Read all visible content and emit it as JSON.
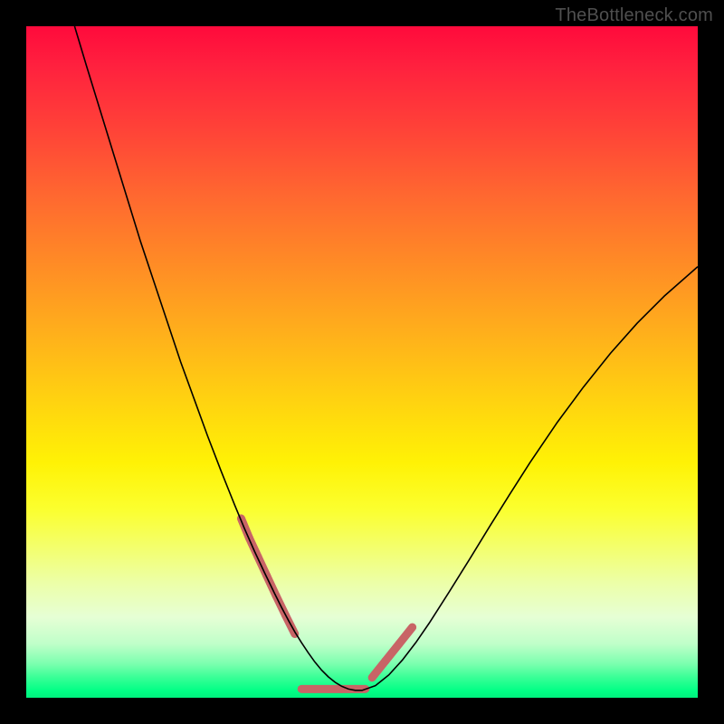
{
  "watermark": "TheBottleneck.com",
  "chart_data": {
    "type": "line",
    "title": "",
    "xlabel": "",
    "ylabel": "",
    "xlim": [
      0,
      100
    ],
    "ylim": [
      0,
      100
    ],
    "grid": false,
    "series": [
      {
        "name": "curve",
        "stroke": "#000000",
        "width": 1.6,
        "x": [
          7.2,
          9,
          11,
          13,
          15,
          17,
          19,
          21,
          23,
          25,
          27,
          29,
          31,
          32.5,
          34,
          35.5,
          37,
          38,
          39,
          40,
          41,
          42,
          43,
          44,
          45,
          46,
          47,
          48,
          49,
          50,
          52,
          54,
          56,
          58,
          60,
          63,
          66,
          69,
          72,
          75,
          79,
          83,
          87,
          91,
          95,
          100
        ],
        "y": [
          100,
          94,
          87.5,
          81,
          74.5,
          68,
          62,
          56,
          50,
          44.5,
          39,
          33.8,
          28.8,
          25.2,
          21.8,
          18.6,
          15.5,
          13.5,
          11.6,
          9.8,
          8.2,
          6.7,
          5.3,
          4.1,
          3.1,
          2.3,
          1.7,
          1.3,
          1.1,
          1.1,
          1.8,
          3.4,
          5.6,
          8.2,
          11.1,
          15.8,
          20.6,
          25.5,
          30.3,
          35,
          40.9,
          46.3,
          51.3,
          55.8,
          59.8,
          64.2
        ]
      }
    ],
    "highlights": [
      {
        "name": "dash-left",
        "stroke": "#c86466",
        "width": 9,
        "cap": "round",
        "x": [
          32.0,
          33.2,
          34.5,
          35.8,
          37.2,
          38.6,
          40.0
        ],
        "y": [
          26.7,
          23.8,
          21.0,
          18.2,
          15.2,
          12.3,
          9.5
        ]
      },
      {
        "name": "dash-bottom",
        "stroke": "#c86466",
        "width": 9,
        "cap": "round",
        "x": [
          41.0,
          43.0,
          45.0,
          47.0,
          49.0,
          50.5
        ],
        "y": [
          1.3,
          1.3,
          1.3,
          1.3,
          1.3,
          1.3
        ]
      },
      {
        "name": "dash-right",
        "stroke": "#c86466",
        "width": 9,
        "cap": "round",
        "x": [
          51.5,
          53.5,
          55.5,
          57.5
        ],
        "y": [
          3.0,
          5.5,
          8.0,
          10.5
        ]
      }
    ],
    "gradient_stops": [
      {
        "pos": 0,
        "color": "#ff0a3c"
      },
      {
        "pos": 25,
        "color": "#ff6730"
      },
      {
        "pos": 55,
        "color": "#ffd011"
      },
      {
        "pos": 78,
        "color": "#f3ff71"
      },
      {
        "pos": 95,
        "color": "#7affae"
      },
      {
        "pos": 100,
        "color": "#00f07e"
      }
    ]
  }
}
